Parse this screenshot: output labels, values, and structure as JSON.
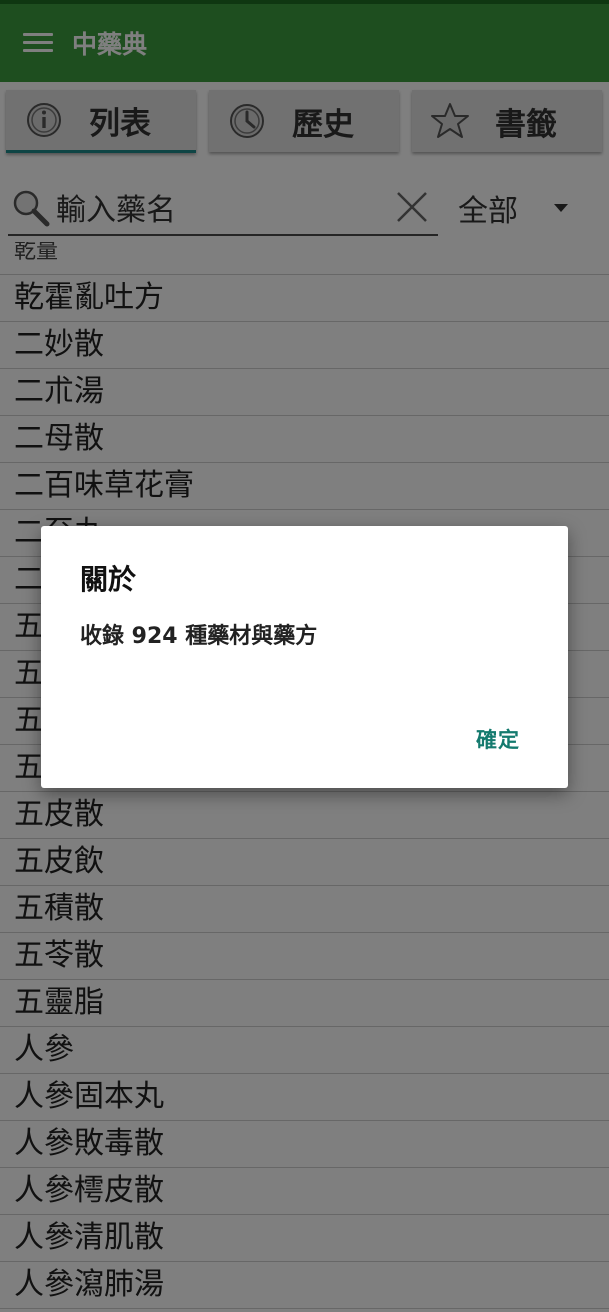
{
  "app": {
    "title": "中藥典"
  },
  "tabs": [
    {
      "label": "列表",
      "icon": "info-icon",
      "active": true
    },
    {
      "label": "歷史",
      "icon": "clock-icon",
      "active": false
    },
    {
      "label": "書籤",
      "icon": "star-icon",
      "active": false
    }
  ],
  "search": {
    "placeholder": "輸入藥名",
    "filter_value": "全部"
  },
  "list": {
    "partial_top": "乾量",
    "items": [
      "乾霍亂吐方",
      "二妙散",
      "二朮湯",
      "二母散",
      "二百味草花膏",
      "二至丸",
      "二",
      "五",
      "五",
      "五",
      "五",
      "五皮散",
      "五皮飲",
      "五積散",
      "五苓散",
      "五靈脂",
      "人參",
      "人參固本丸",
      "人參敗毒散",
      "人參樗皮散",
      "人參清肌散",
      "人參瀉肺湯"
    ]
  },
  "dialog": {
    "title": "關於",
    "message": "收錄 924 種藥材與藥方",
    "ok_label": "確定"
  },
  "colors": {
    "appbar": "#3c9d3f",
    "accent": "#147a6e",
    "tab_indicator": "#1e8b8b"
  }
}
